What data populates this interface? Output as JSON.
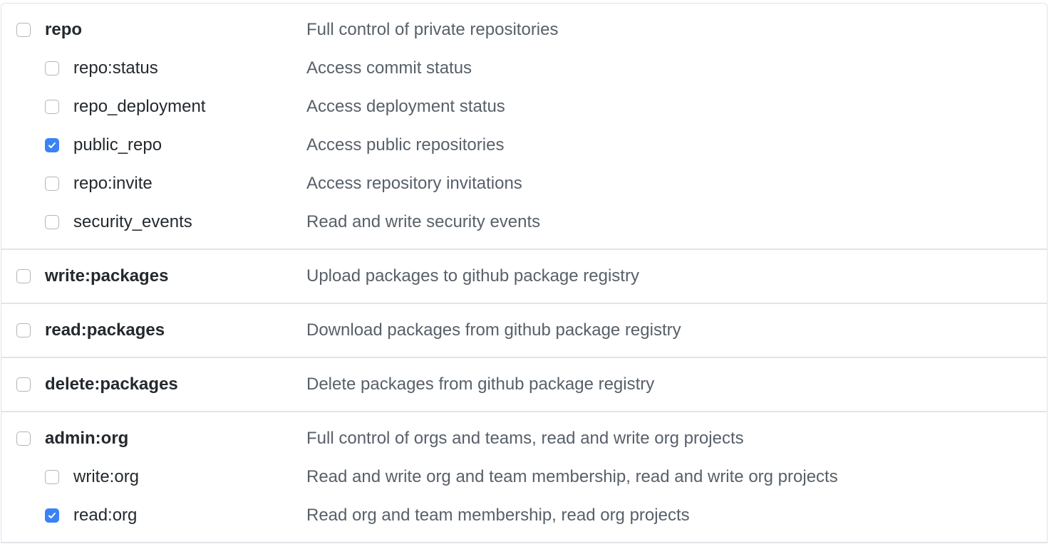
{
  "groups": [
    {
      "rows": [
        {
          "name": "repo",
          "desc": "Full control of private repositories",
          "level": 0,
          "checked": false
        },
        {
          "name": "repo:status",
          "desc": "Access commit status",
          "level": 1,
          "checked": false
        },
        {
          "name": "repo_deployment",
          "desc": "Access deployment status",
          "level": 1,
          "checked": false
        },
        {
          "name": "public_repo",
          "desc": "Access public repositories",
          "level": 1,
          "checked": true
        },
        {
          "name": "repo:invite",
          "desc": "Access repository invitations",
          "level": 1,
          "checked": false
        },
        {
          "name": "security_events",
          "desc": "Read and write security events",
          "level": 1,
          "checked": false
        }
      ]
    },
    {
      "rows": [
        {
          "name": "write:packages",
          "desc": "Upload packages to github package registry",
          "level": 0,
          "checked": false
        }
      ]
    },
    {
      "rows": [
        {
          "name": "read:packages",
          "desc": "Download packages from github package registry",
          "level": 0,
          "checked": false
        }
      ]
    },
    {
      "rows": [
        {
          "name": "delete:packages",
          "desc": "Delete packages from github package registry",
          "level": 0,
          "checked": false
        }
      ]
    },
    {
      "rows": [
        {
          "name": "admin:org",
          "desc": "Full control of orgs and teams, read and write org projects",
          "level": 0,
          "checked": false
        },
        {
          "name": "write:org",
          "desc": "Read and write org and team membership, read and write org projects",
          "level": 1,
          "checked": false
        },
        {
          "name": "read:org",
          "desc": "Read org and team membership, read org projects",
          "level": 1,
          "checked": true
        }
      ]
    }
  ],
  "colors": {
    "accent": "#3b82f6",
    "text": "#24292e",
    "muted": "#586069",
    "border": "#e1e4e8"
  }
}
